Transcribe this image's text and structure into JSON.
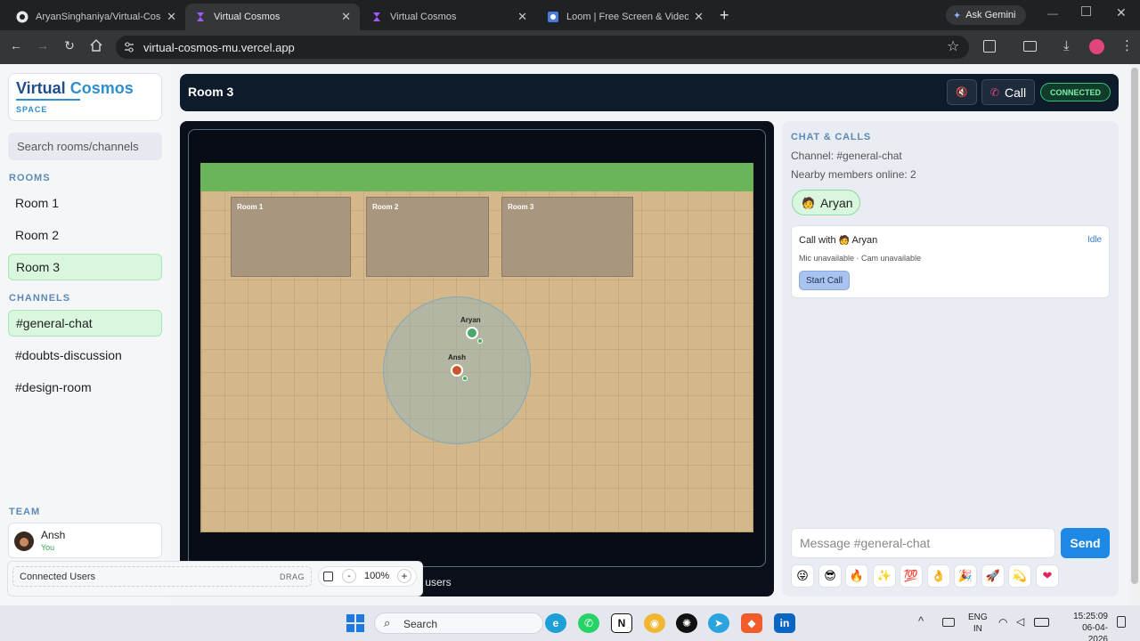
{
  "browser": {
    "tabs": [
      {
        "title": "AryanSinghaniya/Virtual-Cosmo",
        "icon": "github-icon",
        "active": false
      },
      {
        "title": "Virtual Cosmos",
        "icon": "vercel-icon",
        "active": true
      },
      {
        "title": "Virtual Cosmos",
        "icon": "vercel-icon",
        "active": false
      },
      {
        "title": "Loom | Free Screen & Video Re",
        "icon": "loom-icon",
        "active": false
      }
    ],
    "new_tab": "+",
    "ask_gemini": "Ask Gemini",
    "url": "virtual-cosmos-mu.vercel.app",
    "close_glyph": "✕"
  },
  "app": {
    "brand": {
      "word1": "Virtual",
      "word2": "Cosmos",
      "tagline": "SPACE"
    },
    "search_placeholder": "Search rooms/channels",
    "rooms_label": "ROOMS",
    "rooms": [
      "Room 1",
      "Room 2",
      "Room 3"
    ],
    "active_room": "Room 3",
    "channels_label": "CHANNELS",
    "channels": [
      "#general-chat",
      "#doubts-discussion",
      "#design-room"
    ],
    "active_channel": "#general-chat",
    "team_label": "TEAM",
    "team_member": {
      "name": "Ansh",
      "tag": "You"
    },
    "topbar": {
      "room_title": "Room 3",
      "call_label": "Call",
      "status": "CONNECTED"
    },
    "map": {
      "room_labels": [
        "Room 1",
        "Room 2",
        "Room 3"
      ],
      "users": [
        {
          "name": "Aryan"
        },
        {
          "name": "Ansh"
        }
      ]
    },
    "connected_users": {
      "label": "Connected Users",
      "drag": "DRAG",
      "zoom": "100%",
      "minus": "-",
      "plus": "+",
      "trailing": "r users"
    },
    "chat": {
      "heading": "CHAT & CALLS",
      "channel_line": "Channel: #general-chat",
      "nearby_line": "Nearby members online: 2",
      "member_chip": "Aryan",
      "call_card": {
        "prefix": "Call with",
        "name": "Aryan",
        "status": "Idle",
        "devices": "Mic unavailable · Cam unavailable",
        "start_button": "Start Call"
      },
      "input_placeholder": "Message #general-chat",
      "send": "Send",
      "emojis": [
        "😜",
        "😎",
        "🔥",
        "✨",
        "💯",
        "👌",
        "🎉",
        "🚀",
        "💫",
        "❤"
      ]
    }
  },
  "taskbar": {
    "search": "Search",
    "lang_top": "ENG",
    "lang_bottom": "IN",
    "time": "15:25:09",
    "date": "06-04-2026"
  },
  "colors": {
    "accent_green": "#d9f7df",
    "topbar": "#0d1b2a",
    "send": "#1e88e5",
    "brand_blue": "#1f4e8c"
  }
}
